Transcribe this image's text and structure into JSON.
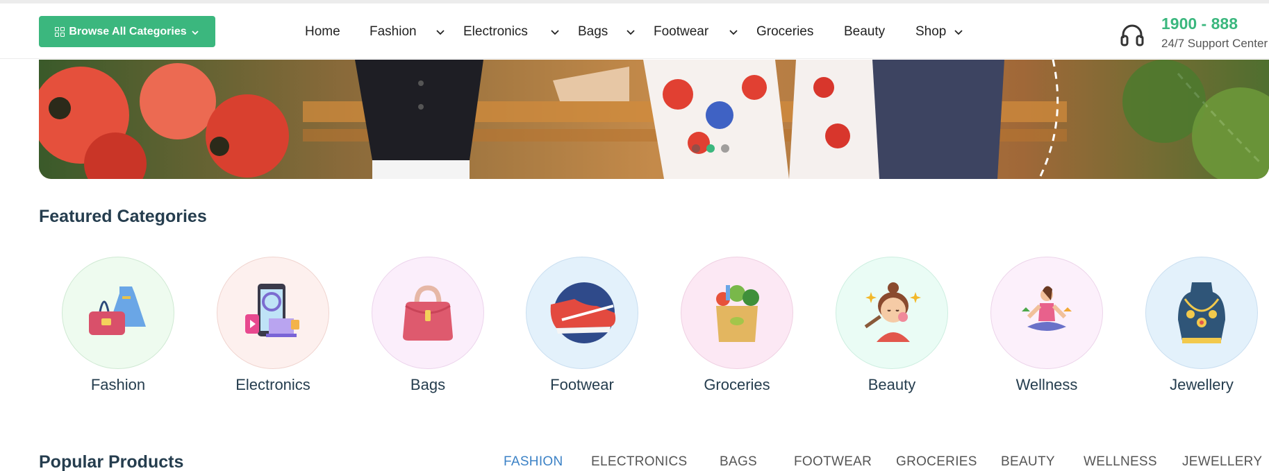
{
  "header": {
    "browse_label": "Browse All Categories",
    "nav": [
      {
        "label": "Home",
        "has_dropdown": false
      },
      {
        "label": "Fashion",
        "has_dropdown": true
      },
      {
        "label": "Electronics",
        "has_dropdown": true
      },
      {
        "label": "Bags",
        "has_dropdown": true
      },
      {
        "label": "Footwear",
        "has_dropdown": true
      },
      {
        "label": "Groceries",
        "has_dropdown": false
      },
      {
        "label": "Beauty",
        "has_dropdown": false
      },
      {
        "label": "Shop",
        "has_dropdown": true
      }
    ],
    "support": {
      "phone": "1900 - 888",
      "subtitle": "24/7 Support Center",
      "icon": "headset-icon"
    }
  },
  "banner": {
    "slide_count": 3,
    "active_slide": 1
  },
  "featured": {
    "title": "Featured Categories",
    "categories": [
      {
        "label": "Fashion",
        "icon": "dress-handbag-icon",
        "bg": "#eefbef"
      },
      {
        "label": "Electronics",
        "icon": "gadgets-icon",
        "bg": "#fdf0ee"
      },
      {
        "label": "Bags",
        "icon": "handbag-icon",
        "bg": "#fbeefb"
      },
      {
        "label": "Footwear",
        "icon": "sneaker-icon",
        "bg": "#e3f1fb"
      },
      {
        "label": "Groceries",
        "icon": "grocery-bag-icon",
        "bg": "#fce8f4"
      },
      {
        "label": "Beauty",
        "icon": "facial-beauty-icon",
        "bg": "#eafcf5"
      },
      {
        "label": "Wellness",
        "icon": "yoga-icon",
        "bg": "#fcf0fb"
      },
      {
        "label": "Jewellery",
        "icon": "necklace-icon",
        "bg": "#e3f1fb"
      }
    ]
  },
  "popular": {
    "title": "Popular Products",
    "tabs": [
      "FASHION",
      "ELECTRONICS",
      "BAGS",
      "FOOTWEAR",
      "GROCERIES",
      "BEAUTY",
      "WELLNESS",
      "JEWELLERY"
    ],
    "active_tab": 0
  },
  "colors": {
    "accent": "#3bb77e",
    "active_tab": "#3c82c6",
    "heading": "#253d4e"
  }
}
